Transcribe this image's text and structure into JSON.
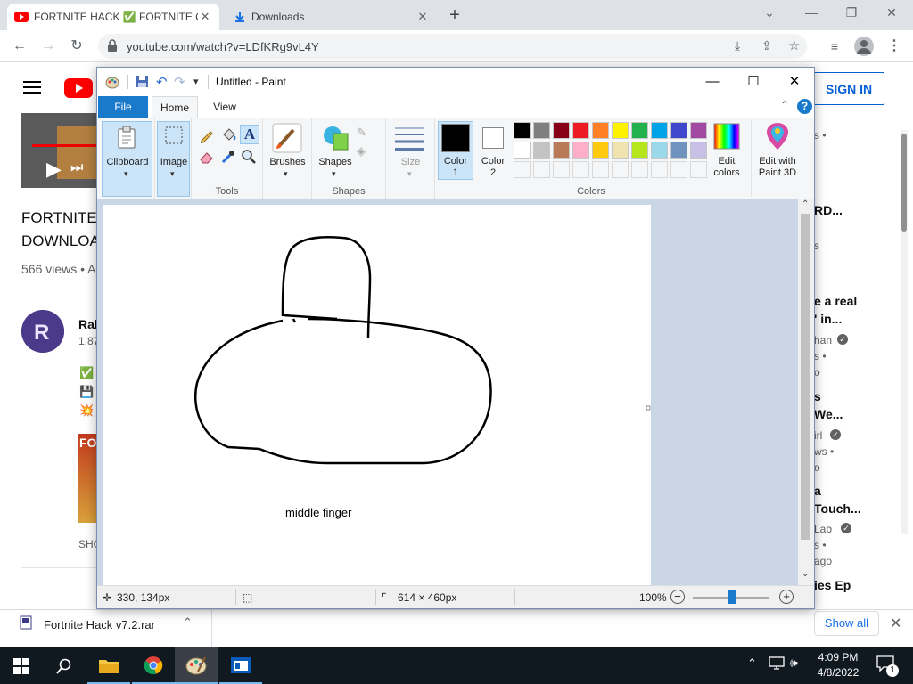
{
  "browser": {
    "tabs": [
      {
        "title": "FORTNITE HACK ✅ FORTNITE C",
        "active": true
      },
      {
        "title": "Downloads",
        "active": false
      }
    ],
    "url": "youtube.com/watch?v=LDfKRg9vL4Y"
  },
  "youtube": {
    "sign_in": "SIGN IN",
    "video_title_line1": "FORTNITE",
    "video_title_line2": "DOWNLOA",
    "views": "566 views • A",
    "channel_initial": "Ral",
    "channel_subs": "1.87",
    "desc_check": "✅",
    "desc_floppy": "💾",
    "desc_boom": "💥",
    "thumb_label": "FO",
    "show_label": "SHO",
    "sidebar": [
      {
        "text": "s •",
        "style": "g"
      },
      {
        "text": "RD...",
        "style": "b"
      },
      {
        "text": "s",
        "style": "g"
      },
      {
        "text": "e a real",
        "style": "b"
      },
      {
        "text": "' in...",
        "style": "b"
      },
      {
        "text": "han",
        "style": "g"
      },
      {
        "text": "s •",
        "style": "g"
      },
      {
        "text": "o",
        "style": "g"
      },
      {
        "text": "s",
        "style": "b"
      },
      {
        "text": "We...",
        "style": "b"
      },
      {
        "text": "irl",
        "style": "g"
      },
      {
        "text": "ws •",
        "style": "g"
      },
      {
        "text": "o",
        "style": "g"
      },
      {
        "text": "a",
        "style": "b"
      },
      {
        "text": "Touch...",
        "style": "b"
      },
      {
        "text": "Lab",
        "style": "g"
      },
      {
        "text": "s •",
        "style": "g"
      },
      {
        "text": "ago",
        "style": "g"
      },
      {
        "text": "ies Ep",
        "style": "b"
      }
    ]
  },
  "downloads": {
    "file": "Fortnite Hack v7.2.rar",
    "show_all": "Show all"
  },
  "paint": {
    "title": "Untitled - Paint",
    "tabs": {
      "file": "File",
      "home": "Home",
      "view": "View"
    },
    "groups": {
      "clipboard": "Clipboard",
      "image": "Image",
      "tools": "Tools",
      "brushes": "Brushes",
      "shapes_btn": "Shapes",
      "shapes_group": "Shapes",
      "size": "Size",
      "color1_a": "Color",
      "color1_b": "1",
      "color2_a": "Color",
      "color2_b": "2",
      "colors_group": "Colors",
      "edit_colors_a": "Edit",
      "edit_colors_b": "colors",
      "paint3d_a": "Edit with",
      "paint3d_b": "Paint 3D"
    },
    "palette_row1": [
      "#000000",
      "#7f7f7f",
      "#880015",
      "#ed1c24",
      "#ff7f27",
      "#fff200",
      "#22b14c",
      "#00a2e8",
      "#3f48cc",
      "#a349a4"
    ],
    "palette_row2": [
      "#ffffff",
      "#c3c3c3",
      "#b97a57",
      "#ffaec9",
      "#ffc90e",
      "#efe4b0",
      "#b5e61d",
      "#99d9ea",
      "#7092be",
      "#c8bfe7"
    ],
    "color1": "#000000",
    "color2": "#ffffff",
    "canvas_text": "middle finger",
    "status": {
      "cursor": "330, 134px",
      "size": "614 × 460px",
      "zoom": "100%"
    }
  },
  "taskbar": {
    "time": "4:09 PM",
    "date": "4/8/2022",
    "notif_count": "1"
  }
}
